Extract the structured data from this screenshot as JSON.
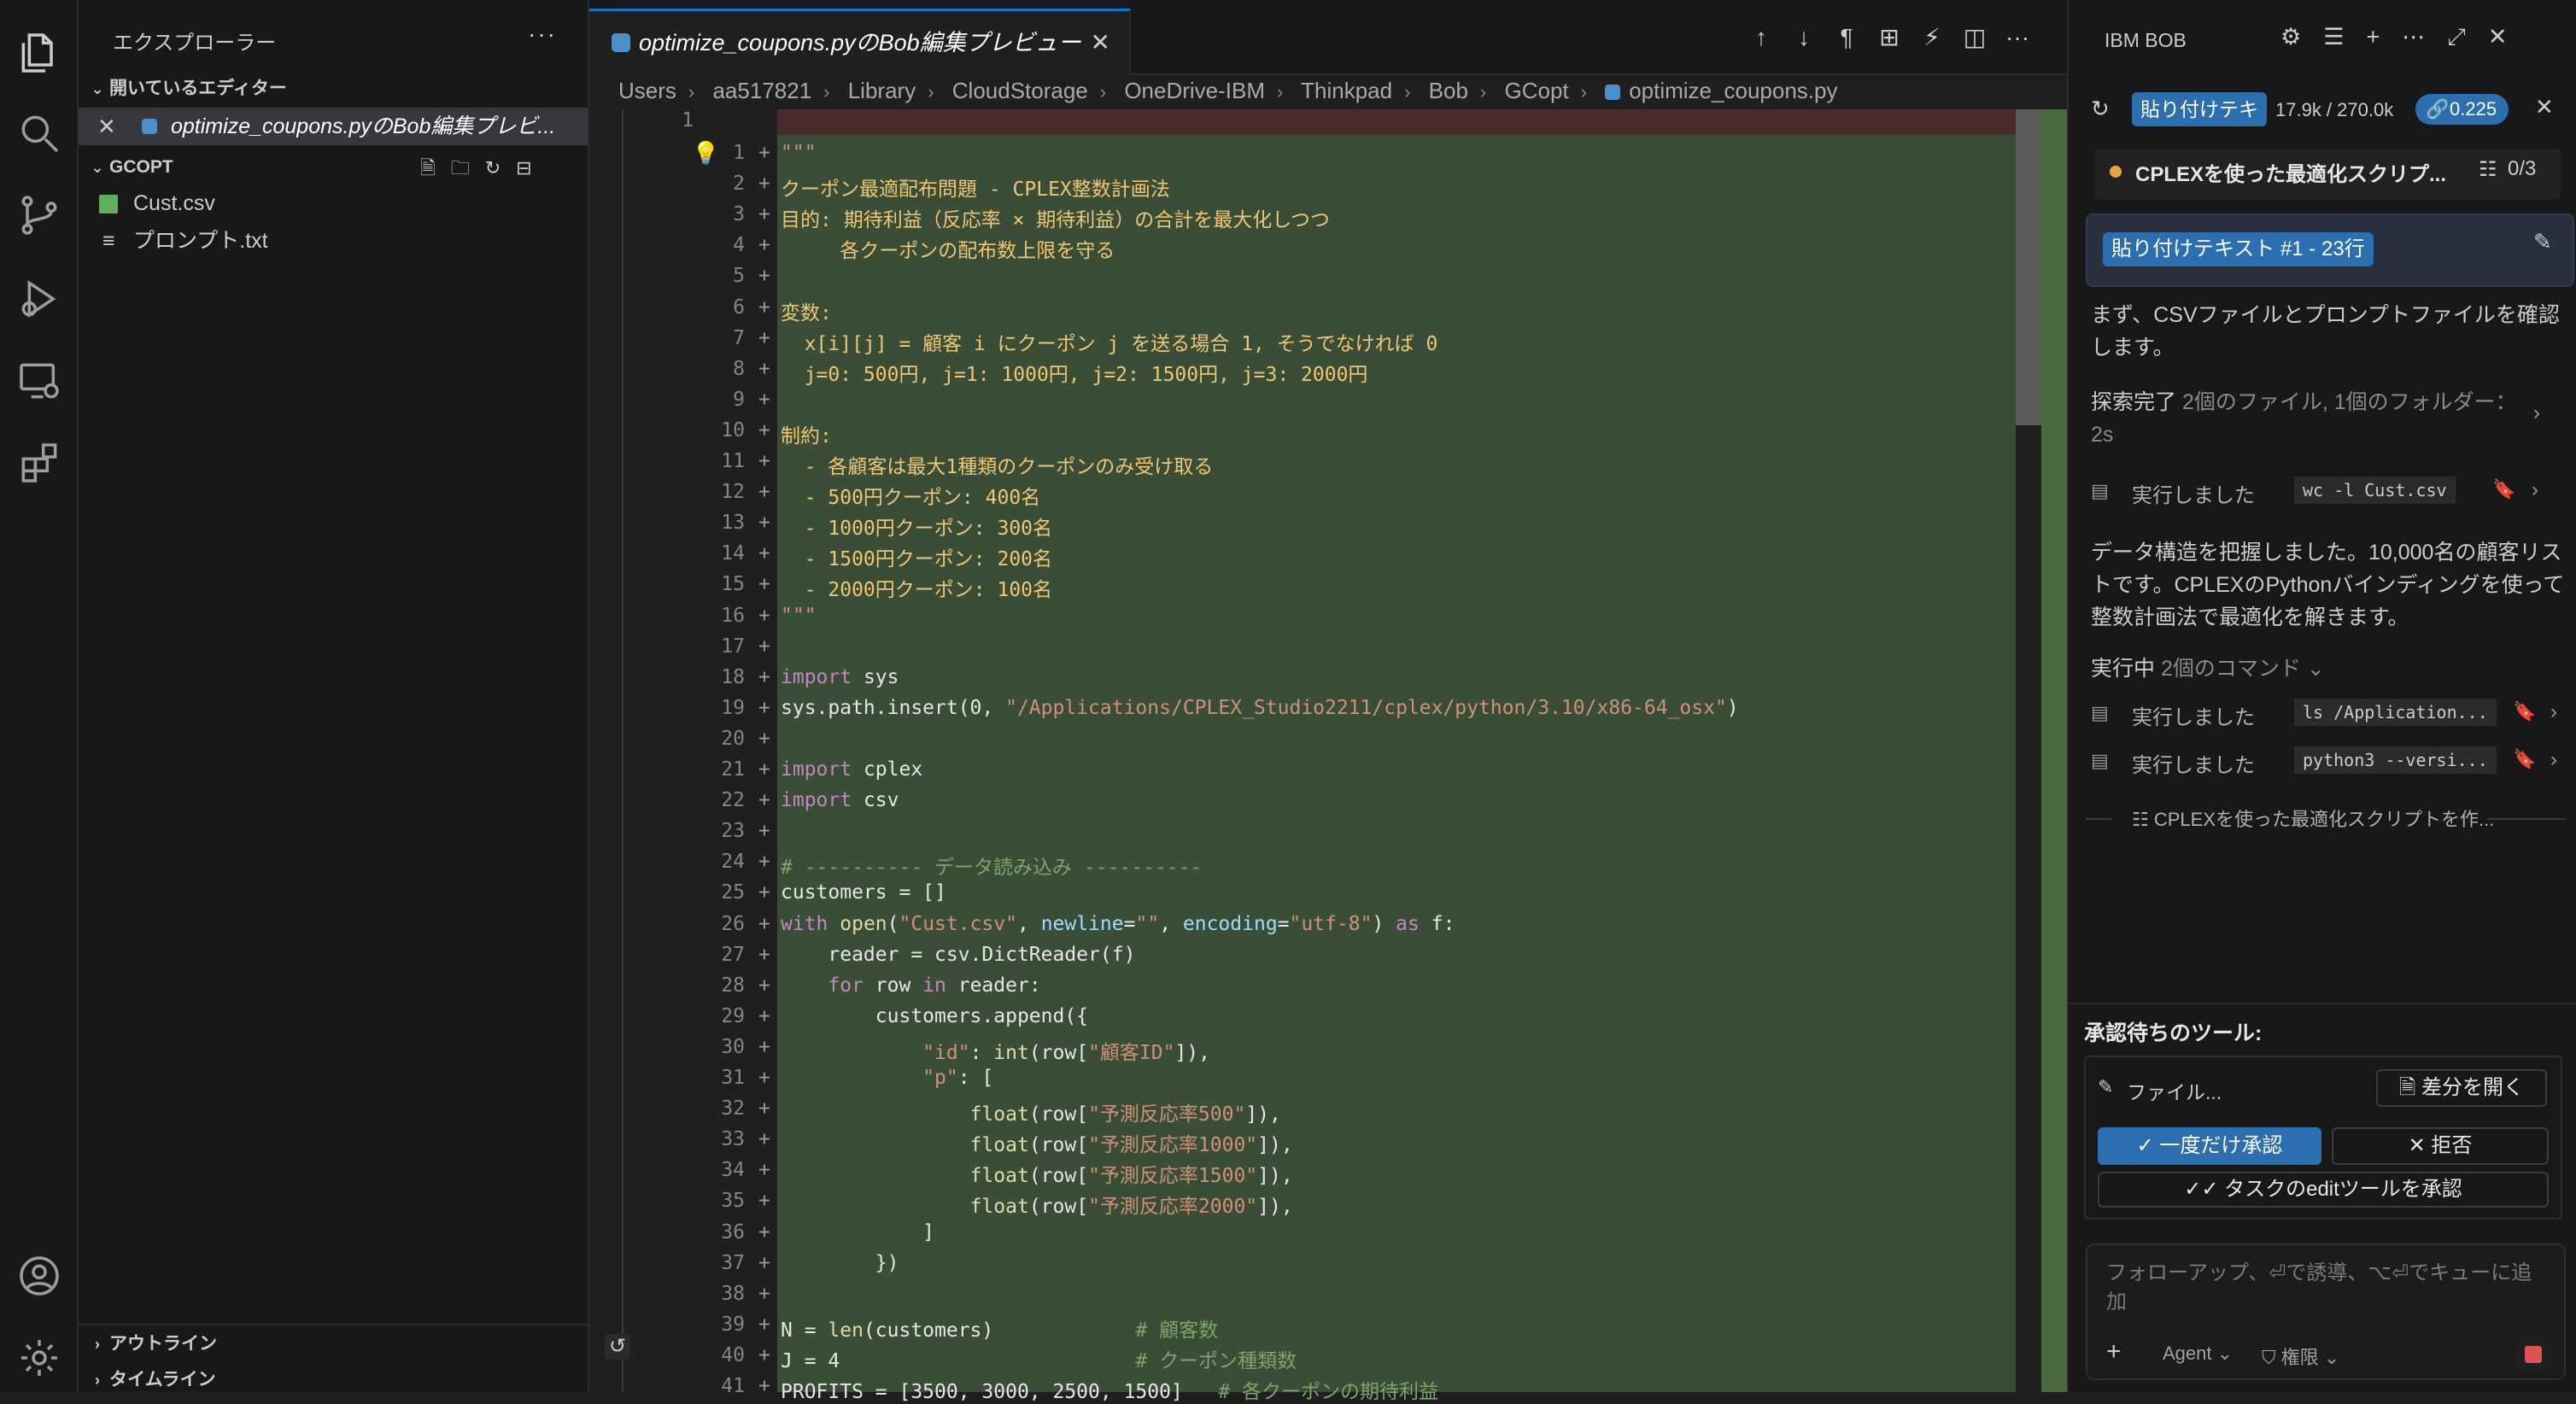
{
  "sidebar": {
    "title": "エクスプローラー",
    "open_editors_label": "開いているエディター",
    "open_editor_item": "optimize_coupons.pyのBob編集プレビ...",
    "folder_label": "GCOPT",
    "files": [
      "Cust.csv",
      "プロンプト.txt"
    ],
    "outline_label": "アウトライン",
    "timeline_label": "タイムライン"
  },
  "editor": {
    "tab_title": "optimize_coupons.pyのBob編集プレビュー",
    "breadcrumb": [
      "Users",
      "aa517821",
      "Library",
      "CloudStorage",
      "OneDrive-IBM",
      "Thinkpad",
      "Bob",
      "GCopt",
      "optimize_coupons.py"
    ],
    "old_line_number": "1",
    "line_numbers": [
      "1",
      "2",
      "3",
      "4",
      "5",
      "6",
      "7",
      "8",
      "9",
      "10",
      "11",
      "12",
      "13",
      "14",
      "15",
      "16",
      "17",
      "18",
      "19",
      "20",
      "21",
      "22",
      "23",
      "24",
      "25",
      "26",
      "27",
      "28",
      "29",
      "30",
      "31",
      "32",
      "33",
      "34",
      "35",
      "36",
      "37",
      "38",
      "39",
      "40",
      "41"
    ],
    "lines": [
      "\"\"\"",
      "クーポン最適配布問題 - CPLEX整数計画法",
      "目的: 期待利益（反応率 × 期待利益）の合計を最大化しつつ",
      "     各クーポンの配布数上限を守る",
      "",
      "変数:",
      "  x[i][j] = 顧客 i にクーポン j を送る場合 1, そうでなければ 0",
      "  j=0: 500円, j=1: 1000円, j=2: 1500円, j=3: 2000円",
      "",
      "制約:",
      "  - 各顧客は最大1種類のクーポンのみ受け取る",
      "  - 500円クーポン: 400名",
      "  - 1000円クーポン: 300名",
      "  - 1500円クーポン: 200名",
      "  - 2000円クーポン: 100名",
      "\"\"\"",
      "",
      "import sys",
      "sys.path.insert(0, \"/Applications/CPLEX_Studio2211/cplex/python/3.10/x86-64_osx\")",
      "",
      "import cplex",
      "import csv",
      "",
      "# ---------- データ読み込み ----------",
      "customers = []",
      "with open(\"Cust.csv\", newline=\"\", encoding=\"utf-8\") as f:",
      "    reader = csv.DictReader(f)",
      "    for row in reader:",
      "        customers.append({",
      "            \"id\": int(row[\"顧客ID\"]),",
      "            \"p\": [",
      "                float(row[\"予測反応率500\"]),",
      "                float(row[\"予測反応率1000\"]),",
      "                float(row[\"予測反応率1500\"]),",
      "                float(row[\"予測反応率2000\"]),",
      "            ]",
      "        })",
      "",
      "N = len(customers)            # 顧客数",
      "J = 4                         # クーポン種類数",
      "PROFITS = [3500, 3000, 2500, 1500]   # 各クーポンの期待利益"
    ]
  },
  "panel": {
    "title": "IBM BOB",
    "paste_chip": "貼り付けテキ",
    "tokens": "17.9k / 270.0k",
    "cost": "0.225",
    "task_title": "CPLEXを使った最適化スクリプ...",
    "task_progress": "0/3",
    "paste_badge": "貼り付けテキスト #1 - 23行",
    "msg1": "まず、CSVファイルとプロンプトファイルを確認します。",
    "explore_label": "探索完了",
    "explore_detail": "2個のファイル, 1個のフォルダー：2s",
    "ran_label": "実行しました",
    "cmd1": "wc -l Cust.csv",
    "msg2": "データ構造を把握しました。10,000名の顧客リストです。CPLEXのPythonバインディングを使って整数計画法で最適化を解きます。",
    "running_label": "実行中",
    "running_detail": "2個のコマンド",
    "cmd2": "ls /Application...",
    "cmd3": "python3 --versi...",
    "todo_item": "CPLEXを使った最適化スクリプトを作...",
    "pending_title": "承認待ちのツール:",
    "file_label": "ファイル...",
    "open_diff": "差分を開く",
    "approve_once": "一度だけ承認",
    "reject": "拒否",
    "approve_edit": "タスクのeditツールを承認",
    "input_placeholder": "フォローアップ、⏎で誘導、⌥⏎でキューに追加",
    "agent_label": "Agent",
    "perm_label": "権限"
  },
  "colors": {
    "accent": "#0078d4",
    "diff_added": "#3a4d36",
    "badge": "#2c6fb0"
  }
}
